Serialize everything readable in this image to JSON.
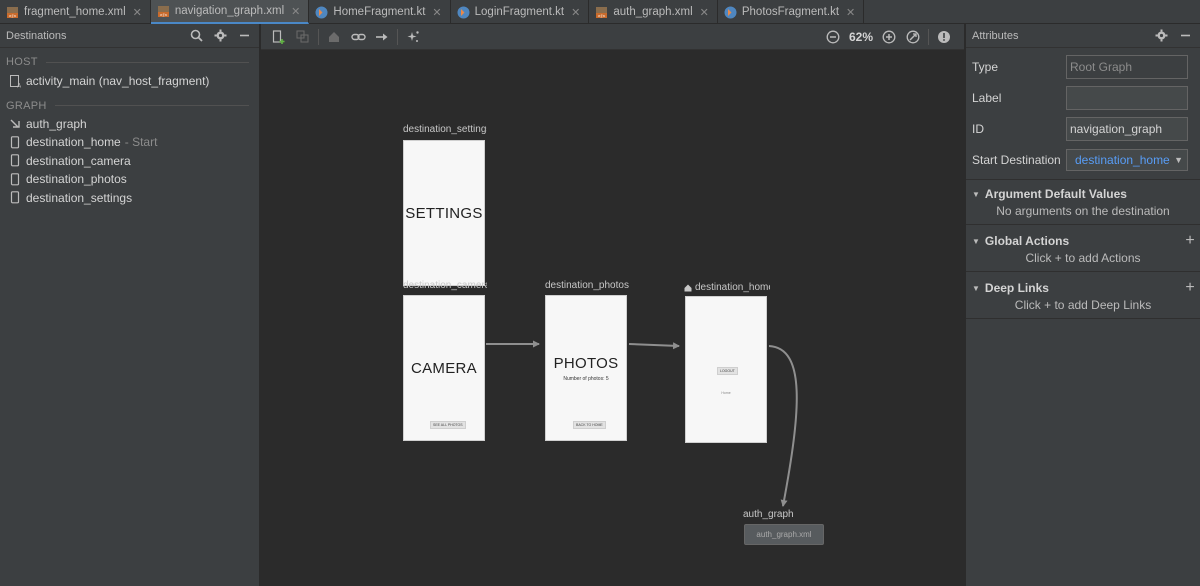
{
  "tabs": [
    {
      "label": "fragment_home.xml",
      "type": "xml",
      "active": false
    },
    {
      "label": "navigation_graph.xml",
      "type": "xml",
      "active": true
    },
    {
      "label": "HomeFragment.kt",
      "type": "kt",
      "active": false
    },
    {
      "label": "LoginFragment.kt",
      "type": "kt",
      "active": false
    },
    {
      "label": "auth_graph.xml",
      "type": "xml",
      "active": false
    },
    {
      "label": "PhotosFragment.kt",
      "type": "kt",
      "active": false
    }
  ],
  "destinations_panel": {
    "title": "Destinations",
    "host_label": "HOST",
    "host_item": "activity_main (nav_host_fragment)",
    "graph_label": "GRAPH",
    "items": [
      {
        "label": "auth_graph",
        "suffix": ""
      },
      {
        "label": "destination_home",
        "suffix": "- Start"
      },
      {
        "label": "destination_camera",
        "suffix": ""
      },
      {
        "label": "destination_photos",
        "suffix": ""
      },
      {
        "label": "destination_settings",
        "suffix": ""
      }
    ]
  },
  "toolbar": {
    "zoom": "62%"
  },
  "canvas": {
    "settings": {
      "label": "destination_settings",
      "title": "SETTINGS"
    },
    "camera": {
      "label": "destination_camera",
      "title": "CAMERA",
      "button": "SEE ALL PHOTOS"
    },
    "photos": {
      "label": "destination_photos",
      "title": "PHOTOS",
      "subtitle": "Number of photos: 5",
      "button": "BACK TO HOME"
    },
    "home": {
      "label": "destination_home",
      "button": "LOGOUT",
      "text": "Home"
    },
    "auth": {
      "label": "auth_graph",
      "file": "auth_graph.xml"
    }
  },
  "attributes_panel": {
    "title": "Attributes",
    "type_label": "Type",
    "type_value": "Root Graph",
    "label_label": "Label",
    "label_value": "",
    "id_label": "ID",
    "id_value": "navigation_graph",
    "start_label": "Start Destination",
    "start_value": "destination_home",
    "sections": [
      {
        "title": "Argument Default Values",
        "body": "No arguments on the destination",
        "has_plus": false
      },
      {
        "title": "Global Actions",
        "body": "Click + to add Actions",
        "has_plus": true
      },
      {
        "title": "Deep Links",
        "body": "Click + to add Deep Links",
        "has_plus": true
      }
    ]
  },
  "colors": {
    "accent": "#4a88c7",
    "link": "#589df6",
    "panel": "#3c3f41",
    "canvas": "#2b2b2b"
  }
}
